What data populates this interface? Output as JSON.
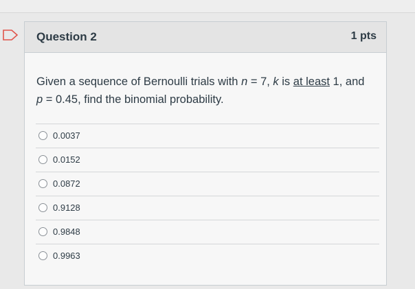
{
  "question": {
    "title": "Question 2",
    "points": "1 pts",
    "text": {
      "part1": "Given a sequence of Bernoulli trials with ",
      "n_var": "n",
      "part2": " = 7, ",
      "k_var": "k",
      "part3": " is ",
      "underlined": "at least",
      "part4": " 1, and",
      "p_var": "p",
      "part5": " = 0.45, find the binomial probability."
    },
    "answers": [
      {
        "label": "0.0037"
      },
      {
        "label": "0.0152"
      },
      {
        "label": "0.0872"
      },
      {
        "label": "0.9128"
      },
      {
        "label": "0.9848"
      },
      {
        "label": "0.9963"
      }
    ]
  },
  "icons": {
    "flag": "flag-question-icon"
  },
  "colors": {
    "text": "#2d3b45",
    "header_bg": "#e4e4e4",
    "card_bg": "#f7f7f7",
    "border": "#c7cdd1"
  }
}
